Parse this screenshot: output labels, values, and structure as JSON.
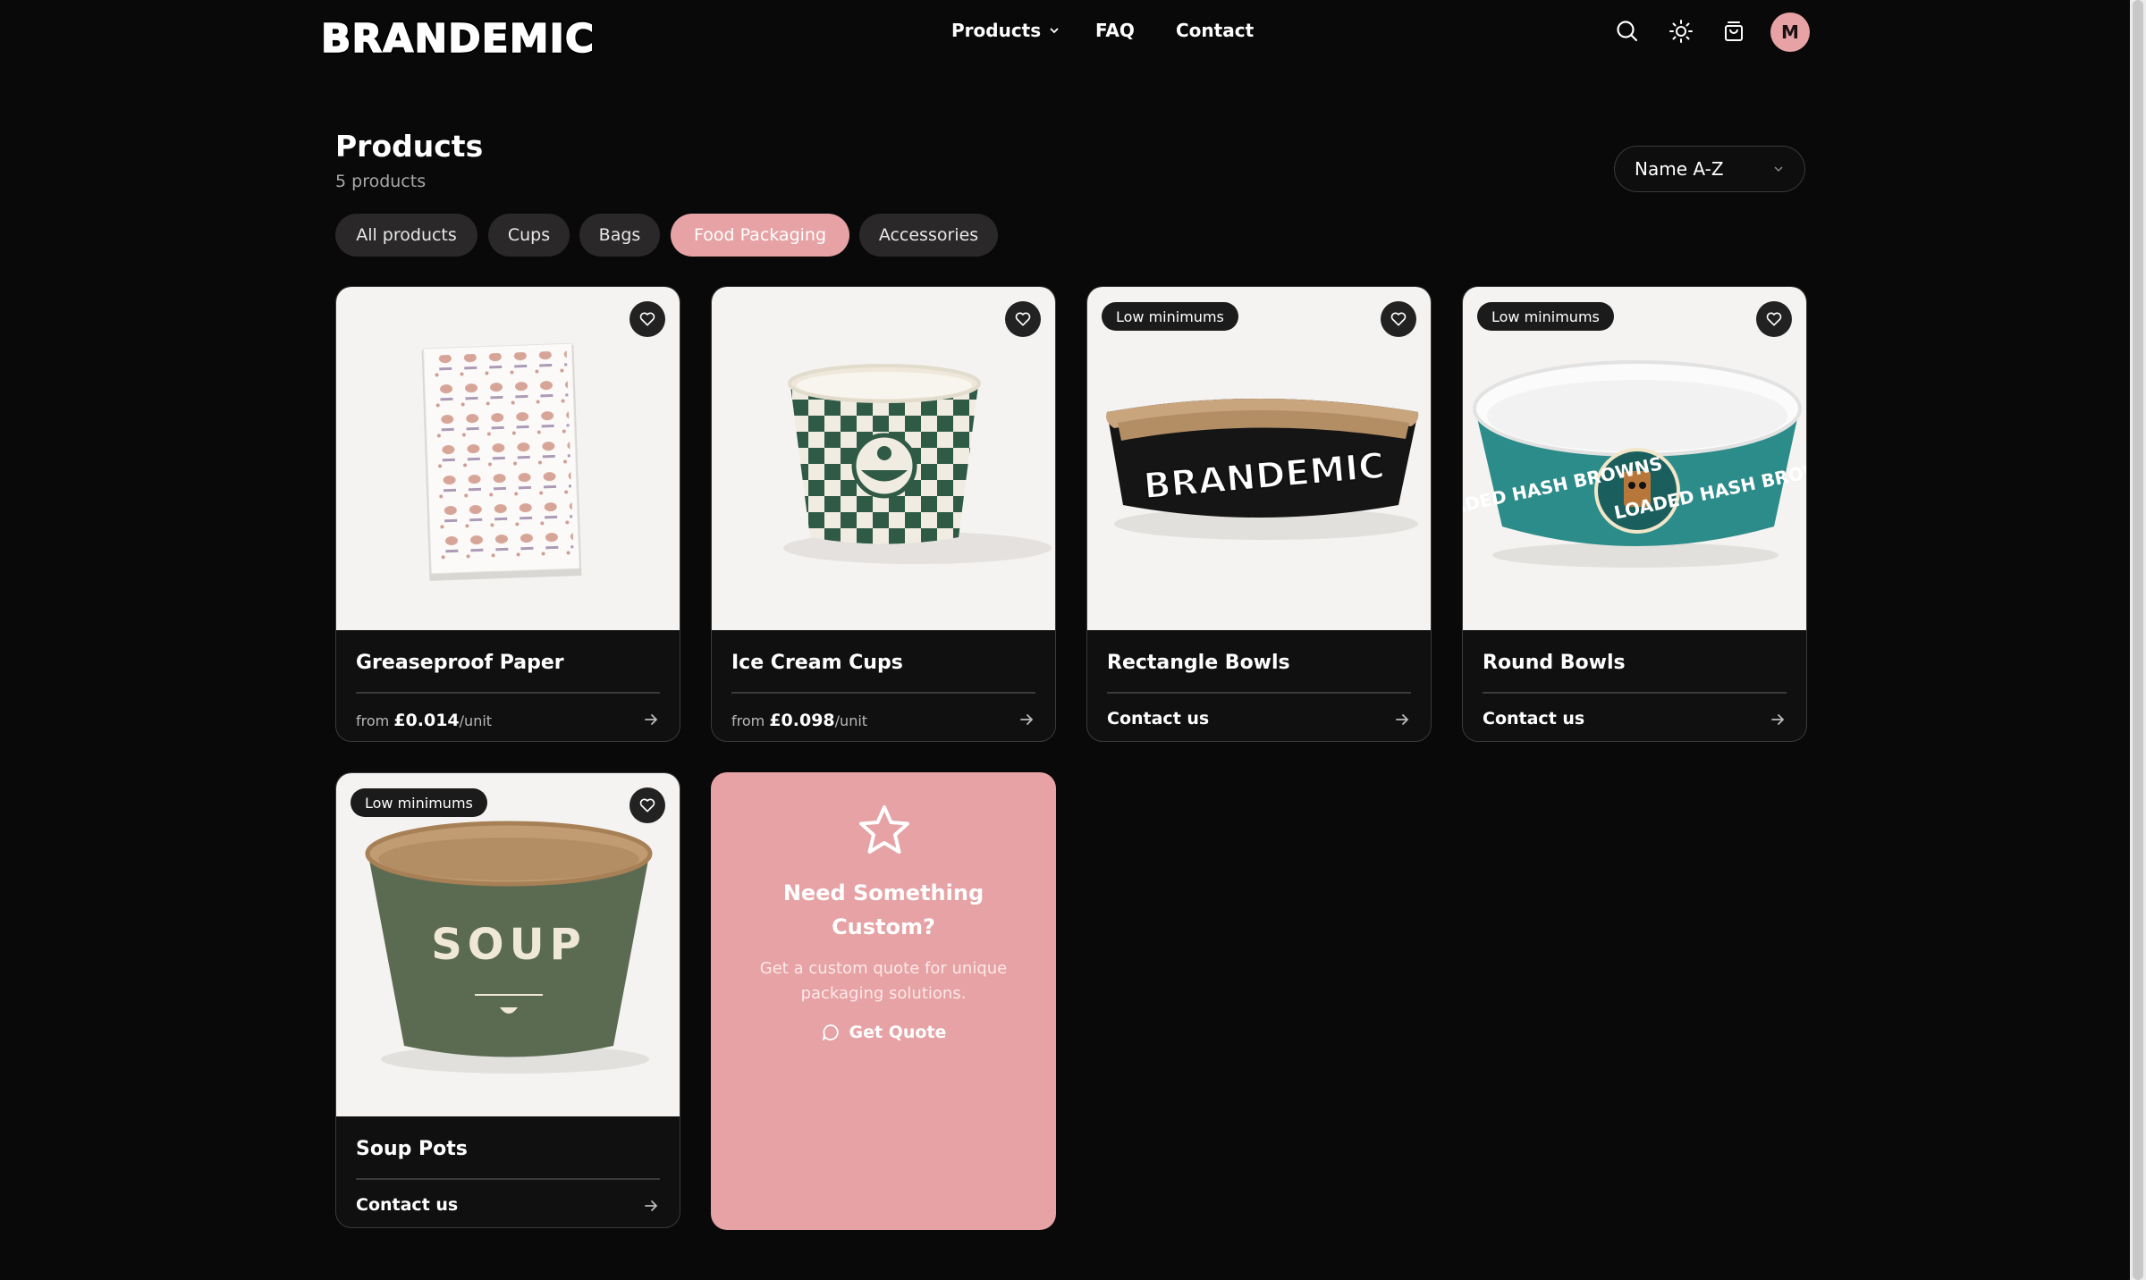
{
  "brand": {
    "logo_text": "BRANDEMIC"
  },
  "nav": {
    "products": "Products",
    "faq": "FAQ",
    "contact": "Contact"
  },
  "header": {
    "avatar_initial": "M"
  },
  "page": {
    "title": "Products",
    "count": "5 products"
  },
  "sort": {
    "selected": "Name A-Z"
  },
  "filters": [
    "All products",
    "Cups",
    "Bags",
    "Food Packaging",
    "Accessories"
  ],
  "filters_active": "Food Packaging",
  "products": [
    {
      "name": "Greaseproof Paper",
      "price_prefix": "from ",
      "price": "£0.014",
      "price_suffix": "/unit",
      "badge": ""
    },
    {
      "name": "Ice Cream Cups",
      "price_prefix": "from ",
      "price": "£0.098",
      "price_suffix": "/unit",
      "badge": ""
    },
    {
      "name": "Rectangle Bowls",
      "cta": "Contact us",
      "badge": "Low minimums",
      "image_text": "BRANDEMIC"
    },
    {
      "name": "Round Bowls",
      "cta": "Contact us",
      "badge": "Low minimums",
      "image_text_left": "LOADED HASH BROWNS",
      "image_text_right": "LOADED HASH BROWNS"
    },
    {
      "name": "Soup Pots",
      "cta": "Contact us",
      "badge": "Low minimums",
      "image_text": "SOUP"
    }
  ],
  "custom": {
    "title_line1": "Need Something",
    "title_line2": "Custom?",
    "description": "Get a custom quote for unique packaging solutions.",
    "cta": "Get Quote"
  },
  "colors": {
    "accent": "#e6a2a4",
    "background": "#0a0909",
    "card_border": "#3a3a3a"
  }
}
